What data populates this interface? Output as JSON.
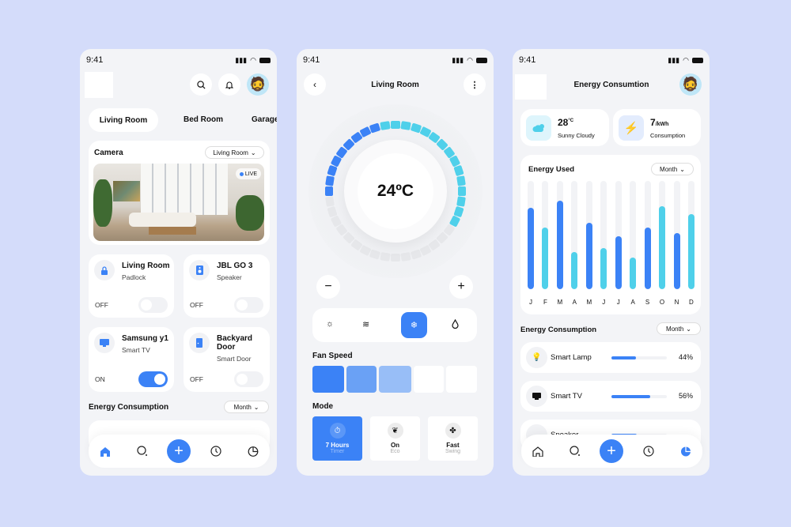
{
  "status": {
    "time": "9:41"
  },
  "colors": {
    "accent": "#3b82f6",
    "cyan": "#4fd0ea",
    "background": "#d4dcfa",
    "inactive": "#e6e7ea"
  },
  "home": {
    "tabs": [
      {
        "label": "Living Room",
        "active": true
      },
      {
        "label": "Bed Room"
      },
      {
        "label": "Garage"
      }
    ],
    "camera": {
      "title": "Camera",
      "room": "Living Room",
      "live": "LIVE"
    },
    "devices": [
      {
        "name": "Living Room",
        "type": "Padlock",
        "state": "OFF",
        "on": false,
        "icon": "lock-icon"
      },
      {
        "name": "JBL GO 3",
        "type": "Speaker",
        "state": "OFF",
        "on": false,
        "icon": "speaker-icon"
      },
      {
        "name": "Samsung y1",
        "type": "Smart TV",
        "state": "ON",
        "on": true,
        "icon": "tv-icon"
      },
      {
        "name": "Backyard Door",
        "type": "Smart Door",
        "state": "OFF",
        "on": false,
        "icon": "door-icon"
      }
    ],
    "energy": {
      "title": "Energy Consumption",
      "period": "Month"
    }
  },
  "thermostat": {
    "title": "Living Room",
    "temperature": "24ºC",
    "dial": {
      "total_ticks": 40,
      "blue_ticks": 9,
      "cyan_ticks": 15
    },
    "modes_bar": [
      {
        "icon": "sun-icon"
      },
      {
        "icon": "wind-icon"
      },
      {
        "icon": "snowflake-icon",
        "active": true
      },
      {
        "icon": "drop-icon"
      }
    ],
    "fan_speed": {
      "label": "Fan Speed",
      "level": 3,
      "max": 5
    },
    "mode": {
      "label": "Mode",
      "cards": [
        {
          "title": "7 Hours",
          "subtitle": "Timer",
          "icon": "timer-icon",
          "active": true
        },
        {
          "title": "On",
          "subtitle": "Eco",
          "icon": "leaf-icon"
        },
        {
          "title": "Fast",
          "subtitle": "Swing",
          "icon": "fan-icon"
        }
      ]
    }
  },
  "energy_screen": {
    "title": "Energy Consumtion",
    "weather": {
      "value": "28",
      "unit": "°C",
      "label": "Sunny Cloudy"
    },
    "consumption": {
      "value": "7",
      "unit": "/kWh",
      "label": "Consumption"
    },
    "chart_title": "Energy Used",
    "chart_period": "Month",
    "list_title": "Energy Consumption",
    "list_period": "Month",
    "items": [
      {
        "name": "Smart Lamp",
        "percent": "44%",
        "value": 44,
        "icon": "lamp-icon"
      },
      {
        "name": "Smart TV",
        "percent": "56%",
        "value": 56,
        "icon": "tv-icon"
      },
      {
        "name": "Speaker",
        "percent": "",
        "value": 35,
        "icon": "speaker-icon"
      }
    ]
  },
  "chart_data": {
    "type": "bar",
    "title": "Energy Used",
    "categories": [
      "J",
      "F",
      "M",
      "A",
      "M",
      "J",
      "J",
      "A",
      "S",
      "O",
      "N",
      "D"
    ],
    "values": [
      75,
      57,
      82,
      34,
      61,
      38,
      49,
      29,
      57,
      77,
      52,
      69
    ],
    "colors": [
      "#3b82f6",
      "#4fd0ea",
      "#3b82f6",
      "#4fd0ea",
      "#3b82f6",
      "#4fd0ea",
      "#3b82f6",
      "#4fd0ea",
      "#3b82f6",
      "#4fd0ea",
      "#3b82f6",
      "#4fd0ea"
    ],
    "ylim": [
      0,
      100
    ],
    "grid": false
  }
}
